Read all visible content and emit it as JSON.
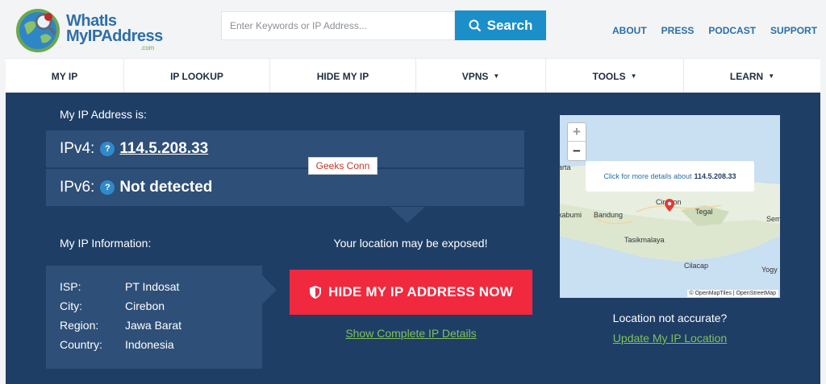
{
  "brand": {
    "line1": "WhatIs",
    "line2": "MyIPAddress",
    "suffix": ".com"
  },
  "search": {
    "placeholder": "Enter Keywords or IP Address...",
    "button_label": "Search"
  },
  "top_links": [
    "ABOUT",
    "PRESS",
    "PODCAST",
    "SUPPORT"
  ],
  "nav": [
    {
      "label": "MY IP",
      "dropdown": false
    },
    {
      "label": "IP LOOKUP",
      "dropdown": false
    },
    {
      "label": "HIDE MY IP",
      "dropdown": false
    },
    {
      "label": "VPNS",
      "dropdown": true
    },
    {
      "label": "TOOLS",
      "dropdown": true
    },
    {
      "label": "LEARN",
      "dropdown": true
    }
  ],
  "ip_section": {
    "heading": "My IP Address is:",
    "ipv4_label": "IPv4:",
    "ipv4_value": "114.5.208.33",
    "ipv6_label": "IPv6:",
    "ipv6_value": "Not detected",
    "help_glyph": "?"
  },
  "tooltip": "Geeks Conn",
  "info": {
    "heading": "My IP Information:",
    "rows": [
      {
        "key": "ISP:",
        "value": "PT Indosat"
      },
      {
        "key": "City:",
        "value": "Cirebon"
      },
      {
        "key": "Region:",
        "value": "Jawa Barat"
      },
      {
        "key": "Country:",
        "value": "Indonesia"
      }
    ]
  },
  "cta": {
    "exposed_text": "Your location may be exposed!",
    "hide_button": "HIDE MY IP ADDRESS NOW",
    "details_link": "Show Complete IP Details"
  },
  "map": {
    "zoom_in": "+",
    "zoom_out": "−",
    "popup_text": "Click for more details about",
    "popup_ip": "114.5.208.33",
    "attribution": "© OpenMapTiles | OpenStreetMap",
    "labels": [
      "arta",
      "kabumi",
      "Bandung",
      "Cirebon",
      "Tegal",
      "Sem",
      "Tasikmalaya",
      "Cilacap",
      "Yogy"
    ]
  },
  "location": {
    "question": "Location not accurate?",
    "update_link": "Update My IP Location"
  },
  "colors": {
    "brand_blue": "#1b8fc9",
    "panel": "#1f3e66",
    "panel_light": "#2e4f78",
    "cta_red": "#f0293e",
    "link_green": "#7cc35a"
  }
}
